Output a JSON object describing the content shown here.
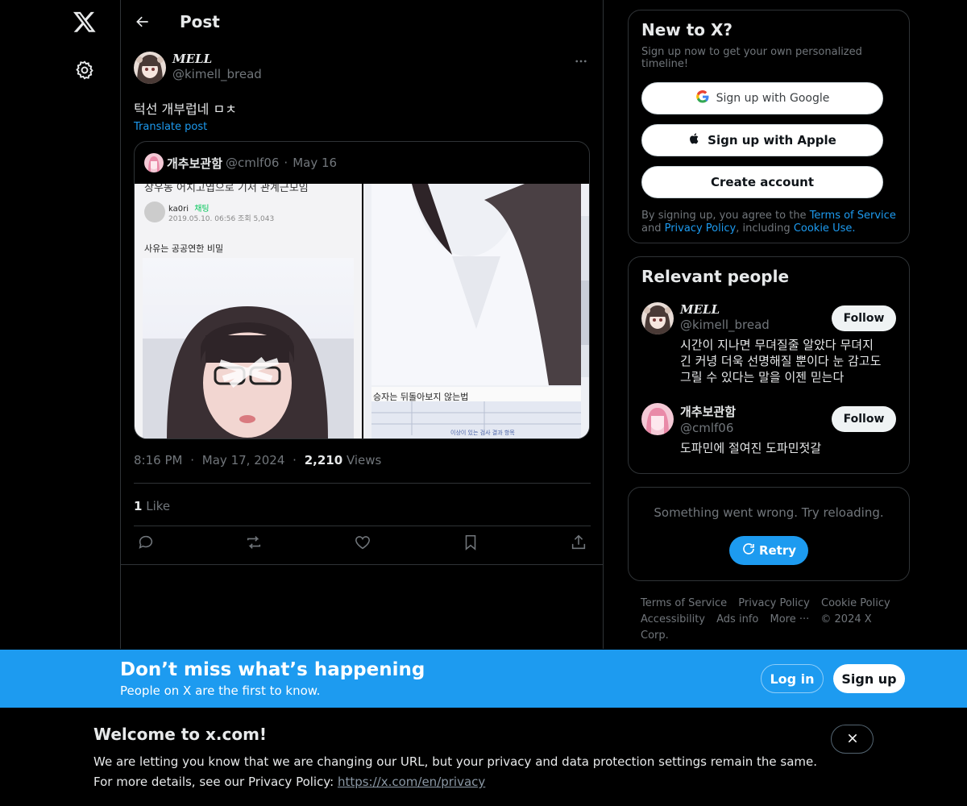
{
  "nav": {
    "logo": "x-logo-icon",
    "settings": "gear-icon"
  },
  "header": {
    "title": "Post"
  },
  "tweet": {
    "display_name": "MELL",
    "handle": "@kimell_bread",
    "text": "턱선 개부럽네 ㅁㅊ",
    "translate": "Translate post",
    "time": "8:16 PM",
    "date": "May 17, 2024",
    "views_count": "2,210",
    "views_label": "Views",
    "likes_count": "1",
    "likes_label": "Like"
  },
  "quote": {
    "name": "개추보관함",
    "handle": "@cmlf06",
    "date": "May 16",
    "left_image": {
      "top_text": "장우동 어치고엽으로 기저 관계근모임",
      "author": "ka0ri",
      "tag": "채팅",
      "meta": "2019.05.10. 06:56  조회 5,043",
      "caption": "사유는 공공연한 비밀"
    },
    "right_image": {
      "caption": "승자는 뒤돌아보지 않는법",
      "foot": "이상이 있는 검사 결과 항목"
    }
  },
  "signup": {
    "title": "New to X?",
    "subtitle": "Sign up now to get your own personalized timeline!",
    "google": "Sign up with Google",
    "apple": "Sign up with Apple",
    "create": "Create account",
    "legal_prefix": "By signing up, you agree to the ",
    "terms": "Terms of Service",
    "and": " and ",
    "privacy": "Privacy Policy",
    "including": ", including ",
    "cookie": "Cookie Use."
  },
  "people": {
    "title": "Relevant people",
    "items": [
      {
        "name": "MELL",
        "handle": "@kimell_bread",
        "bio": "시간이 지나면 무뎌질줄 알았다 무뎌지긴 커녕 더욱 선명해질 뿐이다 눈 감고도 그릴 수 있다는 말을 이젠 믿는다",
        "follow": "Follow"
      },
      {
        "name": "개추보관함",
        "handle": "@cmlf06",
        "bio": "도파민에 절여진 도파민젓갈",
        "follow": "Follow"
      }
    ]
  },
  "error": {
    "text": "Something went wrong. Try reloading.",
    "retry": "Retry"
  },
  "footer": {
    "terms": "Terms of Service",
    "privacy": "Privacy Policy",
    "cookie": "Cookie Policy",
    "accessibility": "Accessibility",
    "ads": "Ads info",
    "more": "More ···",
    "copyright": "© 2024 X Corp."
  },
  "banner": {
    "title": "Don’t miss what’s happening",
    "subtitle": "People on X are the first to know.",
    "login": "Log in",
    "signup": "Sign up"
  },
  "welcome": {
    "title": "Welcome to x.com!",
    "line1": "We are letting you know that we are changing our URL, but your privacy and data protection settings remain the same.",
    "line2_prefix": "For more details, see our Privacy Policy: ",
    "url": "https://x.com/en/privacy"
  },
  "colors": {
    "accent": "#1d9bf0",
    "muted": "#71767b",
    "border": "#2f3336"
  }
}
